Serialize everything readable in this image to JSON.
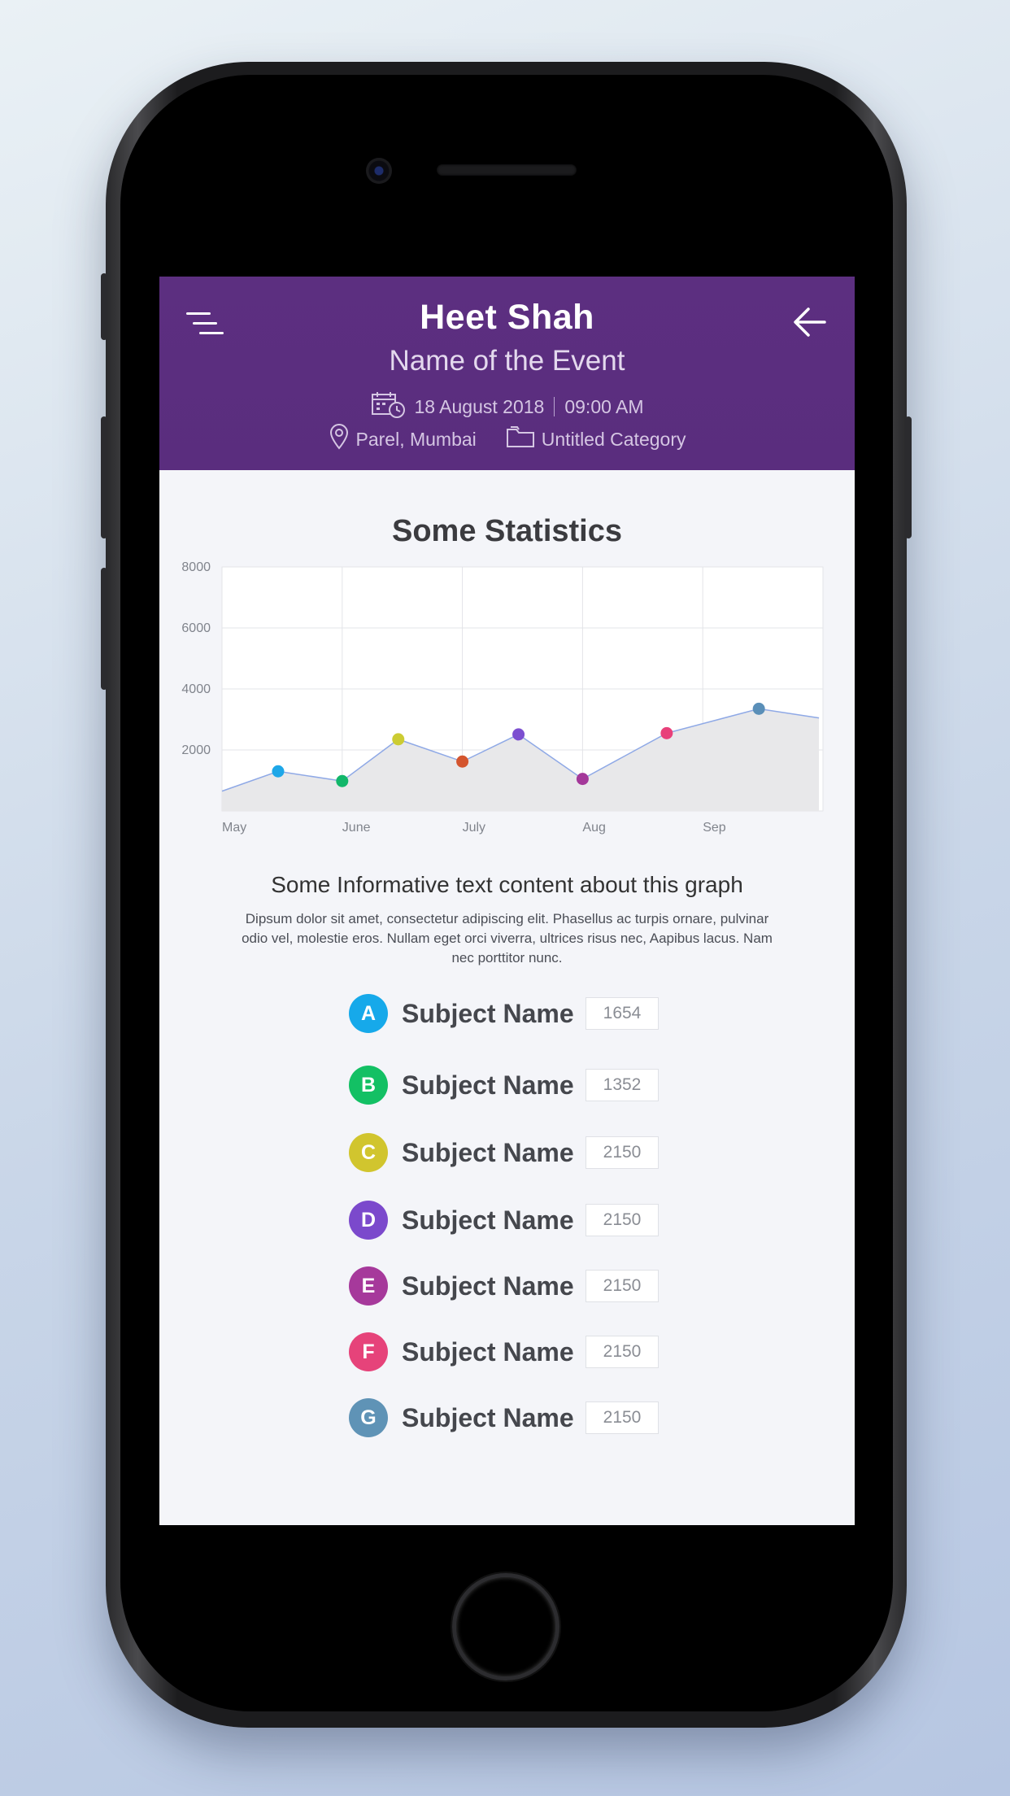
{
  "header": {
    "name": "Heet Shah",
    "event": "Name of the Event",
    "date": "18 August 2018",
    "time": "09:00 AM",
    "location": "Parel, Mumbai",
    "category": "Untitled Category",
    "colors": {
      "background": "#5b2e7f",
      "text": "#ffffff"
    },
    "icons": {
      "menu": "menu-icon",
      "back": "back-arrow-icon",
      "calendar": "calendar-clock-icon",
      "location": "location-pin-icon",
      "category": "folder-icon"
    }
  },
  "stats": {
    "title": "Some Statistics",
    "info_title": "Some Informative text content about this graph",
    "info_body": "Dipsum dolor sit amet, consectetur adipiscing elit. Phasellus ac turpis ornare, pulvinar odio vel, molestie eros. Nullam eget orci viverra, ultrices risus nec, Aapibus lacus. Nam nec porttitor nunc."
  },
  "chart_data": {
    "type": "area",
    "x_tick_labels": [
      "May",
      "June",
      "July",
      "Aug",
      "Sep"
    ],
    "y_tick_labels": [
      "8000",
      "6000",
      "4000",
      "2000"
    ],
    "ylim": [
      0,
      8000
    ],
    "grid": true,
    "line_color": "#8fa9e6",
    "fill_color": "#e8e8ea",
    "points": [
      {
        "x": "May 1",
        "y": 650
      },
      {
        "x": "May 15",
        "y": 1300,
        "marker_color": "#1ea7e8"
      },
      {
        "x": "June 1",
        "y": 980,
        "marker_color": "#12b76a"
      },
      {
        "x": "June 15",
        "y": 2350,
        "marker_color": "#cccc33"
      },
      {
        "x": "July 1",
        "y": 1620,
        "marker_color": "#d4552e"
      },
      {
        "x": "July 15",
        "y": 2510,
        "marker_color": "#7c4fd0"
      },
      {
        "x": "Aug 1",
        "y": 1050,
        "marker_color": "#a4389a"
      },
      {
        "x": "Aug 22",
        "y": 2550,
        "marker_color": "#e8407a"
      },
      {
        "x": "Sep 15",
        "y": 3350,
        "marker_color": "#5a8fb8"
      },
      {
        "x": "Sep 30",
        "y": 3050
      }
    ]
  },
  "subjects": [
    {
      "letter": "A",
      "name": "Subject Name",
      "value": "1654",
      "color": "#16a9ea"
    },
    {
      "letter": "B",
      "name": "Subject Name",
      "value": "1352",
      "color": "#13c064"
    },
    {
      "letter": "C",
      "name": "Subject Name",
      "value": "2150",
      "color": "#d1c52e"
    },
    {
      "letter": "D",
      "name": "Subject Name",
      "value": "2150",
      "color": "#7b49cc"
    },
    {
      "letter": "E",
      "name": "Subject Name",
      "value": "2150",
      "color": "#a6399b"
    },
    {
      "letter": "F",
      "name": "Subject Name",
      "value": "2150",
      "color": "#e6437a"
    },
    {
      "letter": "G",
      "name": "Subject Name",
      "value": "2150",
      "color": "#5f93b6"
    }
  ]
}
